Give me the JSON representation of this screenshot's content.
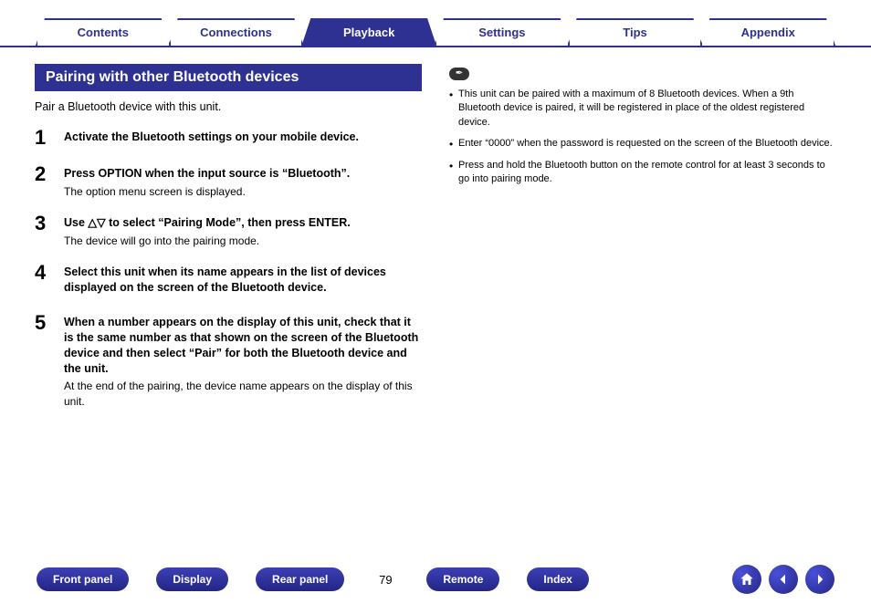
{
  "tabs": [
    {
      "label": "Contents",
      "active": false
    },
    {
      "label": "Connections",
      "active": false
    },
    {
      "label": "Playback",
      "active": true
    },
    {
      "label": "Settings",
      "active": false
    },
    {
      "label": "Tips",
      "active": false
    },
    {
      "label": "Appendix",
      "active": false
    }
  ],
  "section_title": "Pairing with other Bluetooth devices",
  "intro": "Pair a Bluetooth device with this unit.",
  "steps": [
    {
      "num": "1",
      "heading": "Activate the Bluetooth settings on your mobile device.",
      "detail": ""
    },
    {
      "num": "2",
      "heading": "Press OPTION when the input source is “Bluetooth”.",
      "detail": "The option menu screen is displayed."
    },
    {
      "num": "3",
      "heading": "Use △▽ to select “Pairing Mode”, then press ENTER.",
      "detail": "The device will go into the pairing mode."
    },
    {
      "num": "4",
      "heading": "Select this unit when its name appears in the list of devices displayed on the screen of the Bluetooth device.",
      "detail": ""
    },
    {
      "num": "5",
      "heading": "When a number appears on the display of this unit, check that it is the same number as that shown on the screen of the Bluetooth device and then select “Pair” for both the Bluetooth device and the unit.",
      "detail": "At the end of the pairing, the device name appears on the display of this unit."
    }
  ],
  "notes": [
    "This unit can be paired with a maximum of 8 Bluetooth devices. When a 9th Bluetooth device is paired, it will be registered in place of the oldest registered device.",
    "Enter “0000” when the password is requested on the screen of the Bluetooth device.",
    "Press and hold the Bluetooth button on the remote control for at least 3 seconds to go into pairing mode."
  ],
  "note_icon": "✒",
  "bottom_nav": {
    "front_panel": "Front panel",
    "display": "Display",
    "rear_panel": "Rear panel",
    "remote": "Remote",
    "index": "Index"
  },
  "page_number": "79"
}
